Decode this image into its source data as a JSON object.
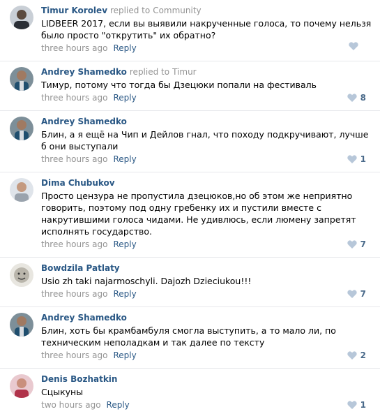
{
  "colors": {
    "link": "#2a5885",
    "muted": "#939393",
    "heart": "#b7c7d9",
    "divider": "#e7e8ec"
  },
  "comments": [
    {
      "author": "Timur Korolev",
      "replied_label": "replied to",
      "reply_to": "Community",
      "text": "LIDBEER 2017, если вы выявили накрученные голоса, то почему нельзя было просто \"открутить\" их обратно?",
      "time": "three hours ago",
      "reply": "Reply",
      "likes": "",
      "avatar_icon": "user-avatar-icon"
    },
    {
      "author": "Andrey Shamedko",
      "replied_label": "replied to",
      "reply_to": "Timur",
      "text": "Тимур, потому что тогда бы Дзецюки попали на фестиваль",
      "time": "three hours ago",
      "reply": "Reply",
      "likes": "8",
      "avatar_icon": "user-avatar-icon"
    },
    {
      "author": "Andrey Shamedko",
      "replied_label": "",
      "reply_to": "",
      "text": "Блин, а я ещё на Чип и Дейлов гнал, что походу подкручивают, лучше б они выступали",
      "time": "three hours ago",
      "reply": "Reply",
      "likes": "1",
      "avatar_icon": "user-avatar-icon"
    },
    {
      "author": "Dima Chubukov",
      "replied_label": "",
      "reply_to": "",
      "text": "Просто цензура не пропустила дзецюков,но об этом же неприятно говорить, поэтому под одну гребенку их и пустили вместе с накрутившими голоса чидами. Не удивлюсь, если люмену запретят исполнять государство.",
      "time": "three hours ago",
      "reply": "Reply",
      "likes": "7",
      "avatar_icon": "user-avatar-icon"
    },
    {
      "author": "Bowdzila Patlaty",
      "replied_label": "",
      "reply_to": "",
      "text": "Usio zh taki najarmoschyli. Dajozh Dzieciukou!!!",
      "time": "three hours ago",
      "reply": "Reply",
      "likes": "7",
      "avatar_icon": "user-avatar-icon"
    },
    {
      "author": "Andrey Shamedko",
      "replied_label": "",
      "reply_to": "",
      "text": "Блин, хоть бы крамбамбуля смогла выступить, а то мало ли, по техническим неполадкам и так далее по тексту",
      "time": "three hours ago",
      "reply": "Reply",
      "likes": "2",
      "avatar_icon": "user-avatar-icon"
    },
    {
      "author": "Denis Bozhatkin",
      "replied_label": "",
      "reply_to": "",
      "text": "Сцыкуны",
      "time": "two hours ago",
      "reply": "Reply",
      "likes": "1",
      "avatar_icon": "user-avatar-icon"
    }
  ]
}
